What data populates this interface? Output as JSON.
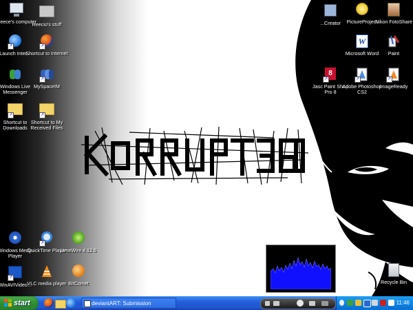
{
  "desktop": {
    "icons_left": [
      {
        "label": "Reece's computer",
        "icon": "my-computer-icon"
      },
      {
        "label": "Reecio's stuff",
        "icon": "folder-icon"
      },
      {
        "label": "Launch Inter...",
        "icon": "internet-explorer-icon"
      },
      {
        "label": "Shortcut to Internet",
        "icon": "firefox-icon"
      },
      {
        "label": "Windows Live Messenger",
        "icon": "messenger-icon"
      },
      {
        "label": "MySpaceIM",
        "icon": "myspaceim-icon"
      },
      {
        "label": "Shortcut to Downloads",
        "icon": "folder-icon"
      },
      {
        "label": "Shortcut to My Received Files",
        "icon": "folder-icon"
      },
      {
        "label": "Windows Media Player",
        "icon": "media-player-icon"
      },
      {
        "label": "QuickTime Player",
        "icon": "quicktime-icon"
      },
      {
        "label": "LimeWire 4.12.6",
        "icon": "limewire-icon"
      },
      {
        "label": "WinAVIVideo...",
        "icon": "winavi-icon"
      },
      {
        "label": "VLC media player",
        "icon": "vlc-icon"
      },
      {
        "label": "BitComet",
        "icon": "bitcomet-icon"
      }
    ],
    "icons_right": [
      {
        "label": "...Creator",
        "icon": "creator-icon"
      },
      {
        "label": "PictureProject",
        "icon": "pictureproject-icon"
      },
      {
        "label": "Nikon FotoShare",
        "icon": "fotoshare-icon"
      },
      {
        "label": "Microsoft Word",
        "icon": "word-icon"
      },
      {
        "label": "Paint",
        "icon": "paint-icon"
      },
      {
        "label": "Jasc Paint Shop Pro 8",
        "icon": "paintshop-icon"
      },
      {
        "label": "Adobe Photoshop CS2",
        "icon": "photoshop-icon"
      },
      {
        "label": "ImageReady",
        "icon": "imageready-icon"
      },
      {
        "label": "Recycle Bin",
        "icon": "recycle-bin-icon"
      }
    ],
    "wallpaper_text": "KORRUPT360",
    "visualizer_color": "#1010ff"
  },
  "taskbar": {
    "start_label": "start",
    "quick_launch": [
      "firefox-icon",
      "folder-icon",
      "internet-explorer-icon"
    ],
    "window_button": "deviantART: Submission",
    "clock": "11:46",
    "colors": {
      "taskbar": "#245edb",
      "start": "#3c9a3c",
      "tray": "#0f84e2"
    }
  }
}
